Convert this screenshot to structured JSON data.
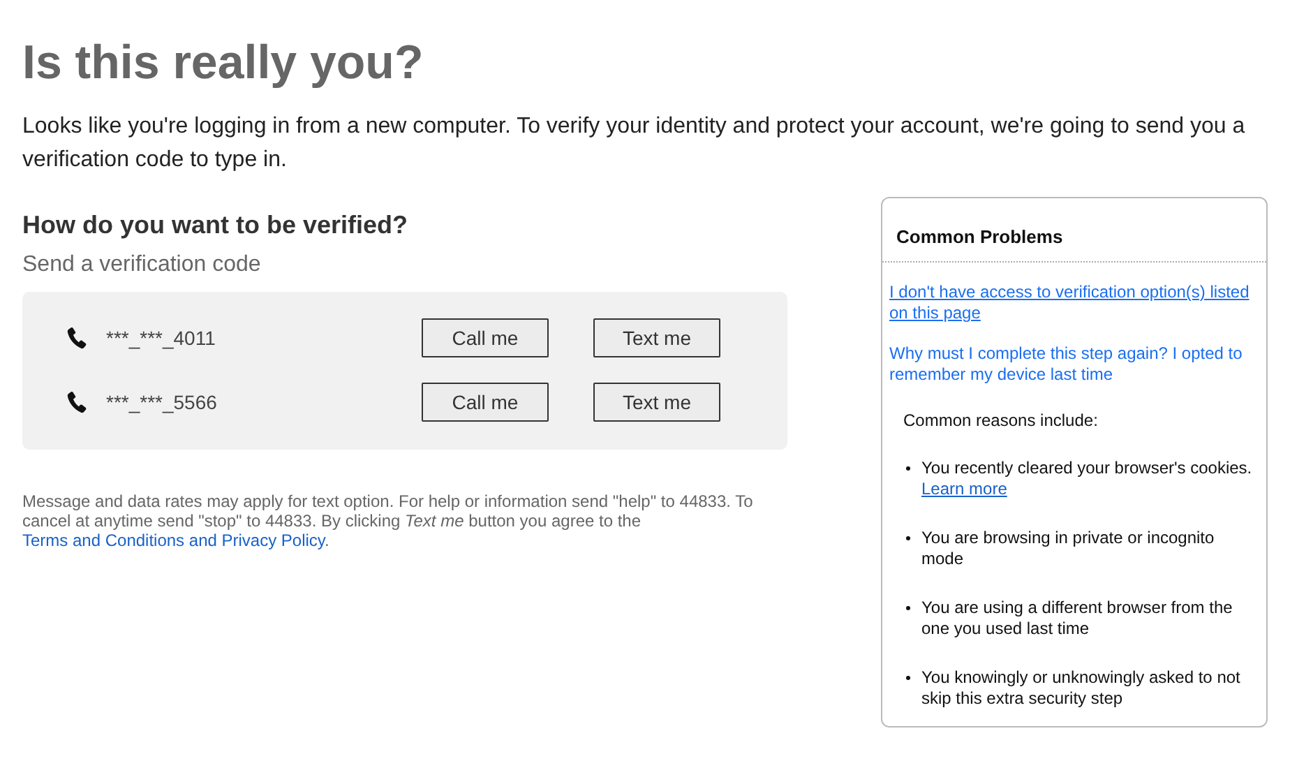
{
  "title": "Is this really you?",
  "intro": "Looks like you're logging in from a new computer. To verify your identity and protect your account, we're going to send you a verification code to type in.",
  "heading": "How do you want to be verified?",
  "subheading": "Send a verification code",
  "phones": [
    {
      "number": "***_***_4011",
      "buttons": [
        "Call me",
        "Text me"
      ]
    },
    {
      "number": "***_***_5566",
      "buttons": [
        "Call me",
        "Text me"
      ]
    }
  ],
  "disclaimer": {
    "text": "Message and data rates may apply for text option. For help or information send \"help\" to 44833. To cancel at anytime send \"stop\" to 44833. By clicking *Text me* button you agree to the",
    "link": "Terms and Conditions and Privacy Policy",
    "end": "."
  },
  "sidebar": {
    "title": "Common Problems",
    "links": [
      {
        "text": "I don't have access to verification option(s) listed on this page",
        "underlined": true
      },
      {
        "text": "Why must I complete this step again? I opted to remember my device last time",
        "underlined": false
      }
    ],
    "reasons_title": "Common reasons include:",
    "reasons": [
      {
        "text": "You recently cleared your browser's cookies.",
        "link": "Learn more"
      },
      {
        "text": "You are browsing in private or incognito mode"
      },
      {
        "text": "You are using a different browser from the one you used last time"
      },
      {
        "text": "You knowingly or unknowingly asked to not skip this extra security step"
      }
    ]
  }
}
